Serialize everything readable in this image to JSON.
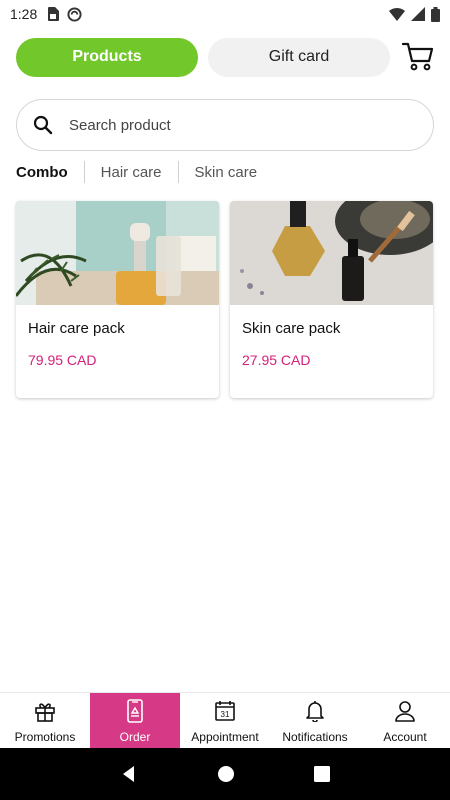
{
  "status_bar": {
    "time": "1:28"
  },
  "top": {
    "products_label": "Products",
    "giftcard_label": "Gift card"
  },
  "search": {
    "placeholder": "Search product"
  },
  "tabs": [
    {
      "label": "Combo",
      "active": true
    },
    {
      "label": "Hair care",
      "active": false
    },
    {
      "label": "Skin care",
      "active": false
    }
  ],
  "products": [
    {
      "name": "Hair care pack",
      "price": "79.95 CAD"
    },
    {
      "name": "Skin care pack",
      "price": "27.95 CAD"
    }
  ],
  "bottom_nav": [
    {
      "label": "Promotions",
      "icon": "gift-icon",
      "active": false
    },
    {
      "label": "Order",
      "icon": "phone-order-icon",
      "active": true
    },
    {
      "label": "Appointment",
      "icon": "calendar-icon",
      "active": false,
      "calendar_day": "31"
    },
    {
      "label": "Notifications",
      "icon": "bell-icon",
      "active": false
    },
    {
      "label": "Account",
      "icon": "user-icon",
      "active": false
    }
  ],
  "colors": {
    "accent_green": "#72c72a",
    "accent_pink": "#d63a86",
    "price_pink": "#d4207a"
  }
}
